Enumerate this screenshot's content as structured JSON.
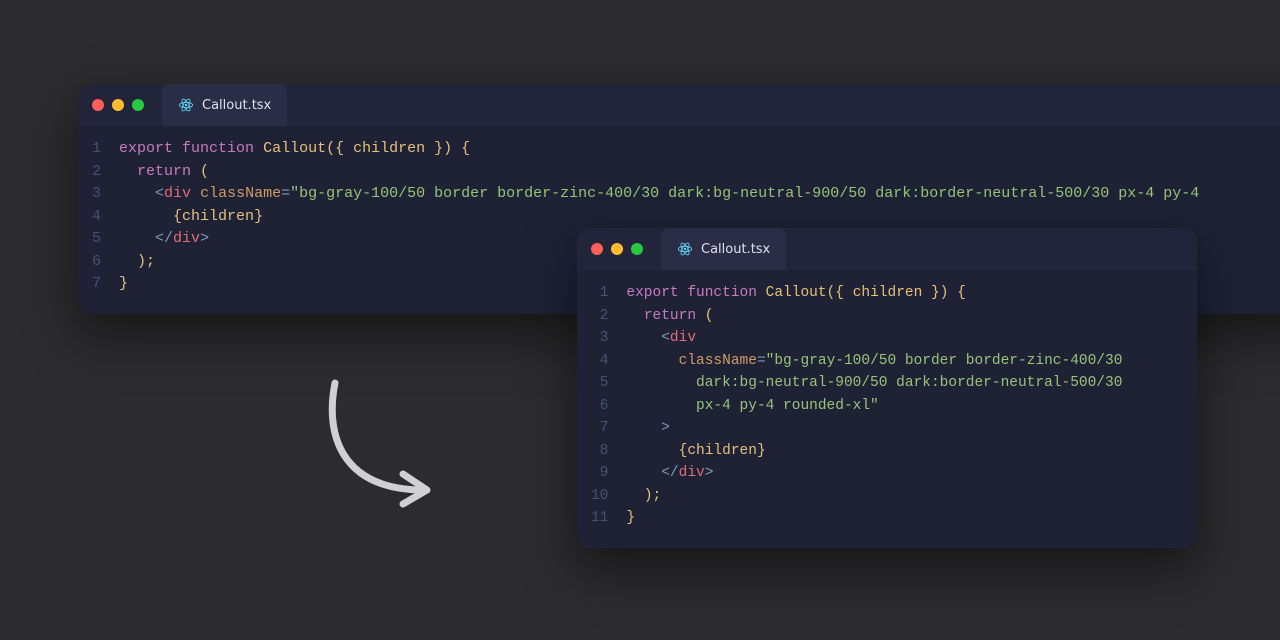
{
  "window_a": {
    "tab": {
      "filename": "Callout.tsx"
    },
    "line_numbers": [
      "1",
      "2",
      "3",
      "4",
      "5",
      "6",
      "7"
    ],
    "code": {
      "l1": {
        "kw1": "export",
        "kw2": "function",
        "fn": "Callout",
        "lp": "(",
        "lb": "{ ",
        "arg": "children",
        "rb": " }",
        "rp": ")",
        "ob": " {"
      },
      "l2": {
        "kw": "return",
        "lp": " ("
      },
      "l3": {
        "lt": "<",
        "tag": "div",
        "sp": " ",
        "attr": "className",
        "eq": "=",
        "str": "\"bg-gray-100/50 border border-zinc-400/30 dark:bg-neutral-900/50 dark:border-neutral-500/30 px-4 py-4"
      },
      "l4": {
        "lb": "{",
        "id": "children",
        "rb": "}"
      },
      "l5": {
        "lt": "</",
        "tag": "div",
        "gt": ">"
      },
      "l6": {
        "rp": ");"
      },
      "l7": {
        "rb": "}"
      }
    }
  },
  "window_b": {
    "tab": {
      "filename": "Callout.tsx"
    },
    "line_numbers": [
      "1",
      "2",
      "3",
      "4",
      "5",
      "6",
      "7",
      "8",
      "9",
      "10",
      "11"
    ],
    "code": {
      "l1": {
        "kw1": "export",
        "kw2": "function",
        "fn": "Callout",
        "lp": "(",
        "lb": "{ ",
        "arg": "children",
        "rb": " }",
        "rp": ")",
        "ob": " {"
      },
      "l2": {
        "kw": "return",
        "lp": " ("
      },
      "l3": {
        "lt": "<",
        "tag": "div"
      },
      "l4": {
        "attr": "className",
        "eq": "=",
        "str": "\"bg-gray-100/50 border border-zinc-400/30"
      },
      "l5": {
        "str": "dark:bg-neutral-900/50 dark:border-neutral-500/30"
      },
      "l6": {
        "str": "px-4 py-4 rounded-xl\""
      },
      "l7": {
        "gt": ">"
      },
      "l8": {
        "lb": "{",
        "id": "children",
        "rb": "}"
      },
      "l9": {
        "lt": "</",
        "tag": "div",
        "gt": ">"
      },
      "l10": {
        "rp": ");"
      },
      "l11": {
        "rb": "}"
      }
    }
  }
}
